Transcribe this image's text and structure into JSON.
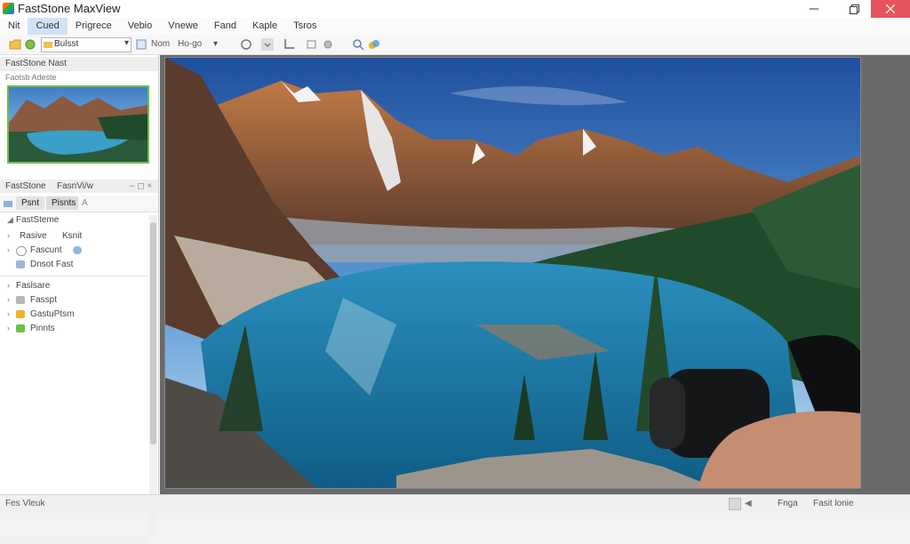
{
  "window": {
    "title": "FastStone MaxView",
    "minimize_icon": "minimize-icon",
    "maximize_icon": "restore-icon",
    "close_icon": "close-icon",
    "accent_close": "#e5545c"
  },
  "menu": {
    "items": [
      {
        "label": "Nit"
      },
      {
        "label": "Cued"
      },
      {
        "label": "Prigrece"
      },
      {
        "label": "Vebio"
      },
      {
        "label": "Vnewe"
      },
      {
        "label": "Fand"
      },
      {
        "label": "Kaple"
      },
      {
        "label": "Tsros"
      }
    ],
    "active_index": 1
  },
  "toolbar": {
    "path_value": "Bulsst",
    "view_label": "Nom",
    "mode_label": "Ho-go"
  },
  "left_panel": {
    "header": "FastStone Nast",
    "subheader": "Faotsb Adeste",
    "section2_header": "FastStone",
    "section2_tab": "FasnVi/w",
    "tabs": [
      {
        "label": "Psnt"
      },
      {
        "label": "Pisnts"
      },
      {
        "label": "A"
      }
    ],
    "tree_root": "FastSteme",
    "tree": [
      {
        "label": "Rasive",
        "extra": "Ksnit"
      },
      {
        "label": "Fascunt"
      },
      {
        "label": "Dnsot Fast"
      },
      {
        "label": "Faslsare"
      },
      {
        "label": "Fasspt"
      },
      {
        "label": "GastuPtsm"
      },
      {
        "label": "Pinnts"
      }
    ]
  },
  "viewer": {
    "image_description_icon": "photo-image"
  },
  "status": {
    "left": "Fes Vleuk",
    "page": "Fnga",
    "right": "Fasit lonie"
  }
}
